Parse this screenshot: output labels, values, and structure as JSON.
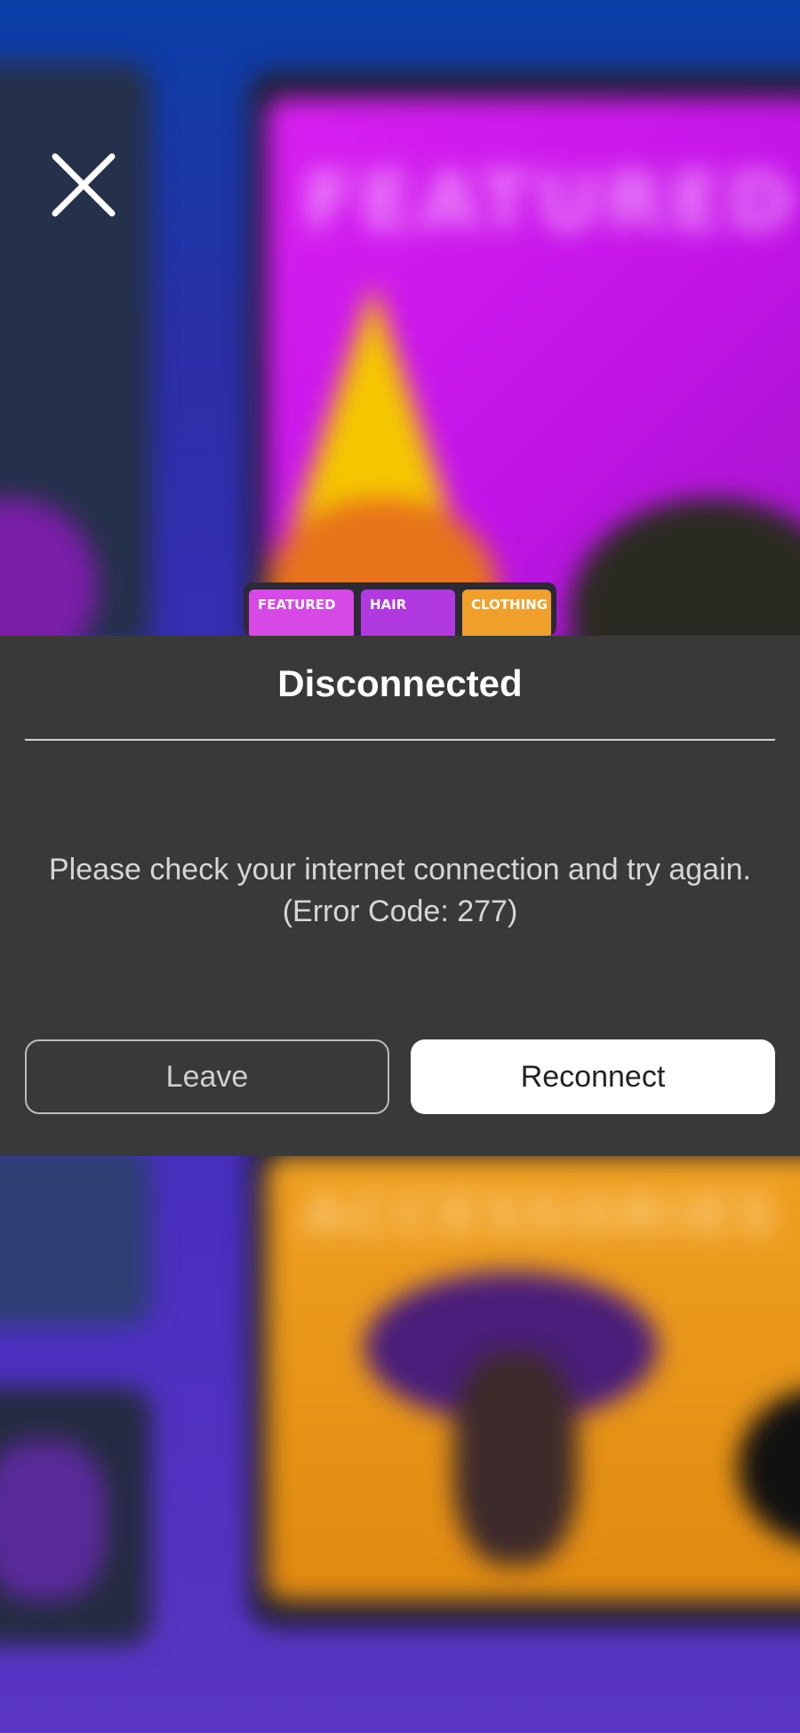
{
  "background": {
    "featured_card_title": "FEATURED",
    "accessories_card_title": "ACCESSORIES",
    "tabs": [
      {
        "label": "FEATURED"
      },
      {
        "label": "HAIR"
      },
      {
        "label": "CLOTHING"
      }
    ]
  },
  "dialog": {
    "title": "Disconnected",
    "message_line1": "Please check your internet connection and try again.",
    "message_line2": "(Error Code: 277)",
    "leave_label": "Leave",
    "reconnect_label": "Reconnect"
  },
  "icons": {
    "close": "close-icon"
  },
  "colors": {
    "dialog_bg": "#393939",
    "primary_button_bg": "#ffffff",
    "secondary_button_border": "#bdbdbd"
  }
}
